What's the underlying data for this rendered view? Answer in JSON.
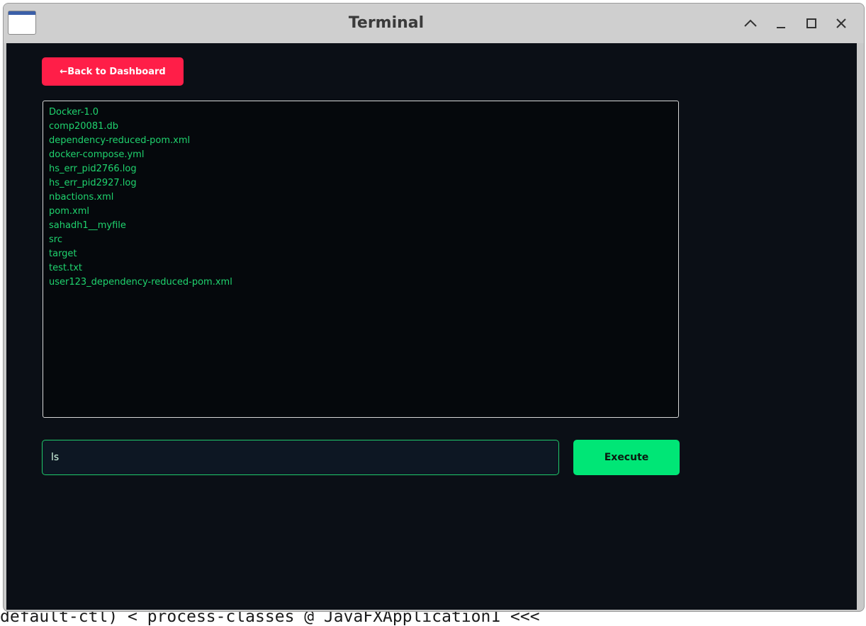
{
  "window": {
    "title": "Terminal",
    "app_icon": "window-icon",
    "controls": [
      "chevron-up-icon",
      "minimize-icon",
      "maximize-icon",
      "close-icon"
    ]
  },
  "background": {
    "bottom_text": "default-ctl) < process-classes @ JavaFXApplication1 <<<"
  },
  "back_button": {
    "label": "←Back to Dashboard",
    "color": "#ff1e48"
  },
  "output": {
    "lines": [
      "Docker-1.0",
      "comp20081.db",
      "dependency-reduced-pom.xml",
      "docker-compose.yml",
      "hs_err_pid2766.log",
      "hs_err_pid2927.log",
      "nbactions.xml",
      "pom.xml",
      "sahadh1__myfile",
      "src",
      "target",
      "test.txt",
      "user123_dependency-reduced-pom.xml"
    ],
    "text_color": "#1fd36e"
  },
  "command": {
    "value": "ls",
    "placeholder": ""
  },
  "execute_button": {
    "label": "Execute",
    "color": "#00e676"
  }
}
